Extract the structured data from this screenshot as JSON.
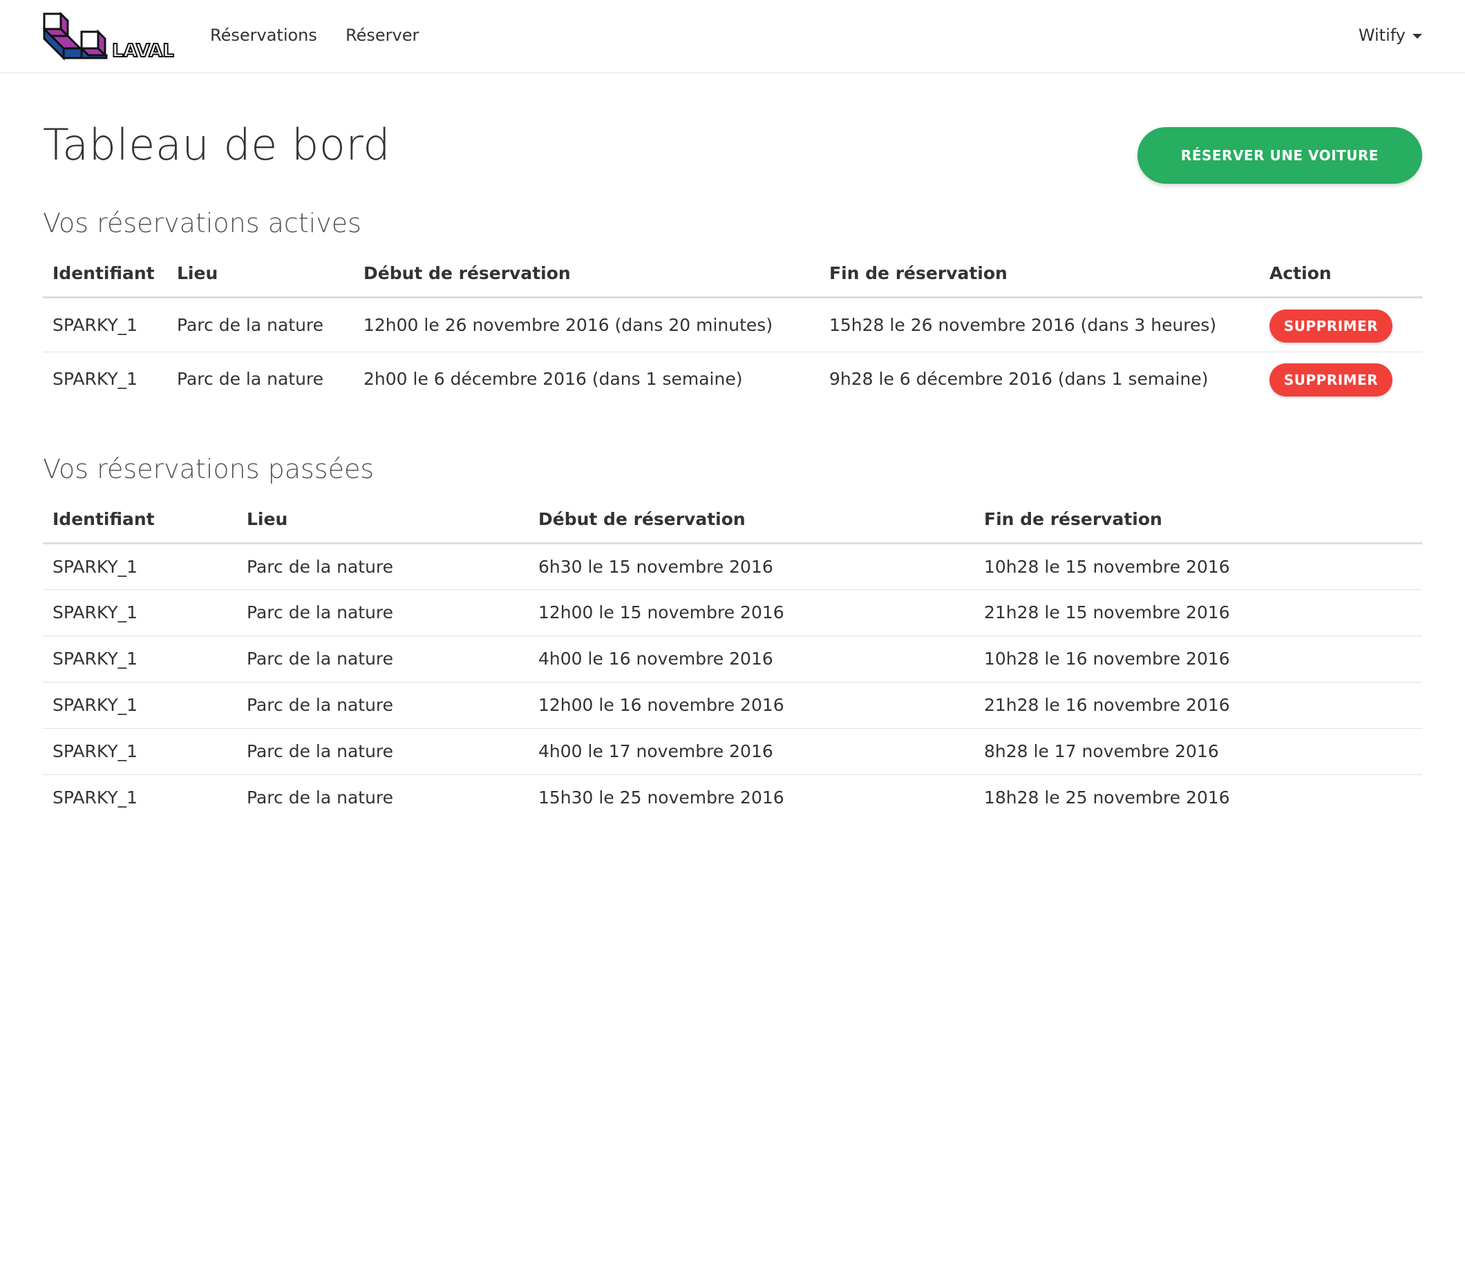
{
  "navbar": {
    "logo_text": "LAVAL",
    "links": [
      "Réservations",
      "Réserver"
    ],
    "user": "Witify"
  },
  "page": {
    "title": "Tableau de bord",
    "reserve_button": "RÉSERVER UNE VOITURE"
  },
  "active": {
    "title": "Vos réservations actives",
    "headers": [
      "Identifiant",
      "Lieu",
      "Début de réservation",
      "Fin de réservation",
      "Action"
    ],
    "rows": [
      {
        "id": "SPARKY_1",
        "lieu": "Parc de la nature",
        "debut": "12h00 le 26 novembre 2016 (dans 20 minutes)",
        "fin": "15h28 le 26 novembre 2016 (dans 3 heures)",
        "action": "SUPPRIMER"
      },
      {
        "id": "SPARKY_1",
        "lieu": "Parc de la nature",
        "debut": "2h00 le 6 décembre 2016 (dans 1 semaine)",
        "fin": "9h28 le 6 décembre 2016 (dans 1 semaine)",
        "action": "SUPPRIMER"
      }
    ]
  },
  "past": {
    "title": "Vos réservations passées",
    "headers": [
      "Identifiant",
      "Lieu",
      "Début de réservation",
      "Fin de réservation"
    ],
    "rows": [
      {
        "id": "SPARKY_1",
        "lieu": "Parc de la nature",
        "debut": "6h30 le 15 novembre 2016",
        "fin": "10h28 le 15 novembre 2016"
      },
      {
        "id": "SPARKY_1",
        "lieu": "Parc de la nature",
        "debut": "12h00 le 15 novembre 2016",
        "fin": "21h28 le 15 novembre 2016"
      },
      {
        "id": "SPARKY_1",
        "lieu": "Parc de la nature",
        "debut": "4h00 le 16 novembre 2016",
        "fin": "10h28 le 16 novembre 2016"
      },
      {
        "id": "SPARKY_1",
        "lieu": "Parc de la nature",
        "debut": "12h00 le 16 novembre 2016",
        "fin": "21h28 le 16 novembre 2016"
      },
      {
        "id": "SPARKY_1",
        "lieu": "Parc de la nature",
        "debut": "4h00 le 17 novembre 2016",
        "fin": "8h28 le 17 novembre 2016"
      },
      {
        "id": "SPARKY_1",
        "lieu": "Parc de la nature",
        "debut": "15h30 le 25 novembre 2016",
        "fin": "18h28 le 25 novembre 2016"
      }
    ]
  },
  "colors": {
    "primary_button": "#27ae60",
    "danger_button": "#f1403a",
    "logo_magenta": "#a43aa6",
    "logo_blue": "#1a4f9c"
  }
}
